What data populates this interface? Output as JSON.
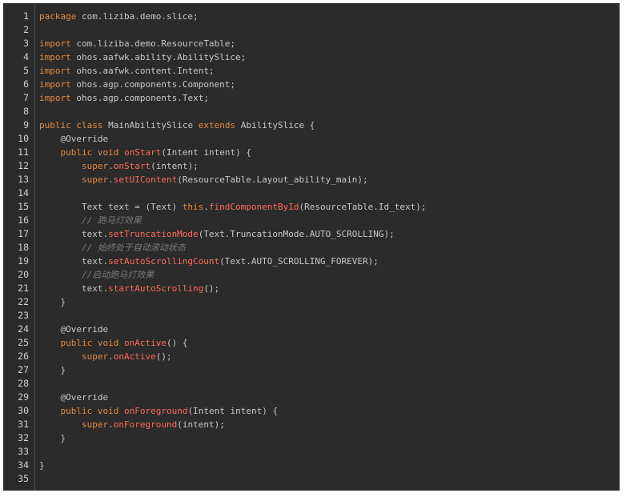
{
  "editor": {
    "lines": [
      {
        "n": "1",
        "segs": [
          [
            "kw",
            "package"
          ],
          [
            "pn",
            " com.liziba.demo.slice;"
          ]
        ]
      },
      {
        "n": "2",
        "segs": []
      },
      {
        "n": "3",
        "segs": [
          [
            "kw",
            "import"
          ],
          [
            "pn",
            " com.liziba.demo.ResourceTable;"
          ]
        ]
      },
      {
        "n": "4",
        "segs": [
          [
            "kw",
            "import"
          ],
          [
            "pn",
            " ohos.aafwk.ability.AbilitySlice;"
          ]
        ]
      },
      {
        "n": "5",
        "segs": [
          [
            "kw",
            "import"
          ],
          [
            "pn",
            " ohos.aafwk.content.Intent;"
          ]
        ]
      },
      {
        "n": "6",
        "segs": [
          [
            "kw",
            "import"
          ],
          [
            "pn",
            " ohos.agp.components.Component;"
          ]
        ]
      },
      {
        "n": "7",
        "segs": [
          [
            "kw",
            "import"
          ],
          [
            "pn",
            " ohos.agp.components.Text;"
          ]
        ]
      },
      {
        "n": "8",
        "segs": []
      },
      {
        "n": "9",
        "segs": [
          [
            "kw",
            "public"
          ],
          [
            "pn",
            " "
          ],
          [
            "kw",
            "class"
          ],
          [
            "pn",
            " MainAbilitySlice "
          ],
          [
            "kw",
            "extends"
          ],
          [
            "pn",
            " AbilitySlice {"
          ]
        ]
      },
      {
        "n": "10",
        "segs": [
          [
            "pn",
            "    "
          ],
          [
            "an",
            "@Override"
          ]
        ]
      },
      {
        "n": "11",
        "segs": [
          [
            "pn",
            "    "
          ],
          [
            "kw",
            "public"
          ],
          [
            "pn",
            " "
          ],
          [
            "kw",
            "void"
          ],
          [
            "pn",
            " "
          ],
          [
            "fn",
            "onStart"
          ],
          [
            "pn",
            "(Intent intent) {"
          ]
        ]
      },
      {
        "n": "12",
        "segs": [
          [
            "pn",
            "        "
          ],
          [
            "kw",
            "super"
          ],
          [
            "pn",
            "."
          ],
          [
            "fn",
            "onStart"
          ],
          [
            "pn",
            "(intent);"
          ]
        ]
      },
      {
        "n": "13",
        "segs": [
          [
            "pn",
            "        "
          ],
          [
            "kw",
            "super"
          ],
          [
            "pn",
            "."
          ],
          [
            "fn",
            "setUIContent"
          ],
          [
            "pn",
            "(ResourceTable.Layout_ability_main);"
          ]
        ]
      },
      {
        "n": "14",
        "segs": []
      },
      {
        "n": "15",
        "segs": [
          [
            "pn",
            "        Text text = (Text) "
          ],
          [
            "kw",
            "this"
          ],
          [
            "pn",
            "."
          ],
          [
            "fn",
            "findComponentById"
          ],
          [
            "pn",
            "(ResourceTable.Id_text);"
          ]
        ]
      },
      {
        "n": "16",
        "segs": [
          [
            "pn",
            "        "
          ],
          [
            "cm",
            "// 跑马灯效果"
          ]
        ]
      },
      {
        "n": "17",
        "segs": [
          [
            "pn",
            "        text."
          ],
          [
            "fn",
            "setTruncationMode"
          ],
          [
            "pn",
            "(Text.TruncationMode.AUTO_SCROLLING);"
          ]
        ]
      },
      {
        "n": "18",
        "segs": [
          [
            "pn",
            "        "
          ],
          [
            "cm",
            "// 始终处于自动滚动状态"
          ]
        ]
      },
      {
        "n": "19",
        "segs": [
          [
            "pn",
            "        text."
          ],
          [
            "fn",
            "setAutoScrollingCount"
          ],
          [
            "pn",
            "(Text.AUTO_SCROLLING_FOREVER);"
          ]
        ]
      },
      {
        "n": "20",
        "segs": [
          [
            "pn",
            "        "
          ],
          [
            "cm",
            "//启动跑马灯效果"
          ]
        ]
      },
      {
        "n": "21",
        "segs": [
          [
            "pn",
            "        text."
          ],
          [
            "fn",
            "startAutoScrolling"
          ],
          [
            "pn",
            "();"
          ]
        ]
      },
      {
        "n": "22",
        "segs": [
          [
            "pn",
            "    }"
          ]
        ]
      },
      {
        "n": "23",
        "segs": []
      },
      {
        "n": "24",
        "segs": [
          [
            "pn",
            "    "
          ],
          [
            "an",
            "@Override"
          ]
        ]
      },
      {
        "n": "25",
        "segs": [
          [
            "pn",
            "    "
          ],
          [
            "kw",
            "public"
          ],
          [
            "pn",
            " "
          ],
          [
            "kw",
            "void"
          ],
          [
            "pn",
            " "
          ],
          [
            "fn",
            "onActive"
          ],
          [
            "pn",
            "() {"
          ]
        ]
      },
      {
        "n": "26",
        "segs": [
          [
            "pn",
            "        "
          ],
          [
            "kw",
            "super"
          ],
          [
            "pn",
            "."
          ],
          [
            "fn",
            "onActive"
          ],
          [
            "pn",
            "();"
          ]
        ]
      },
      {
        "n": "27",
        "segs": [
          [
            "pn",
            "    }"
          ]
        ]
      },
      {
        "n": "28",
        "segs": []
      },
      {
        "n": "29",
        "segs": [
          [
            "pn",
            "    "
          ],
          [
            "an",
            "@Override"
          ]
        ]
      },
      {
        "n": "30",
        "segs": [
          [
            "pn",
            "    "
          ],
          [
            "kw",
            "public"
          ],
          [
            "pn",
            " "
          ],
          [
            "kw",
            "void"
          ],
          [
            "pn",
            " "
          ],
          [
            "fn",
            "onForeground"
          ],
          [
            "pn",
            "(Intent intent) {"
          ]
        ]
      },
      {
        "n": "31",
        "segs": [
          [
            "pn",
            "        "
          ],
          [
            "kw",
            "super"
          ],
          [
            "pn",
            "."
          ],
          [
            "fn",
            "onForeground"
          ],
          [
            "pn",
            "(intent);"
          ]
        ]
      },
      {
        "n": "32",
        "segs": [
          [
            "pn",
            "    }"
          ]
        ]
      },
      {
        "n": "33",
        "segs": []
      },
      {
        "n": "34",
        "segs": [
          [
            "pn",
            "}"
          ]
        ]
      },
      {
        "n": "35",
        "segs": []
      }
    ]
  },
  "colors": {
    "background": "#2b2b2b",
    "keyword": "#e58a3d",
    "method": "#ff6a5a",
    "comment": "#7a7a7a",
    "plain": "#c8c8c8"
  }
}
